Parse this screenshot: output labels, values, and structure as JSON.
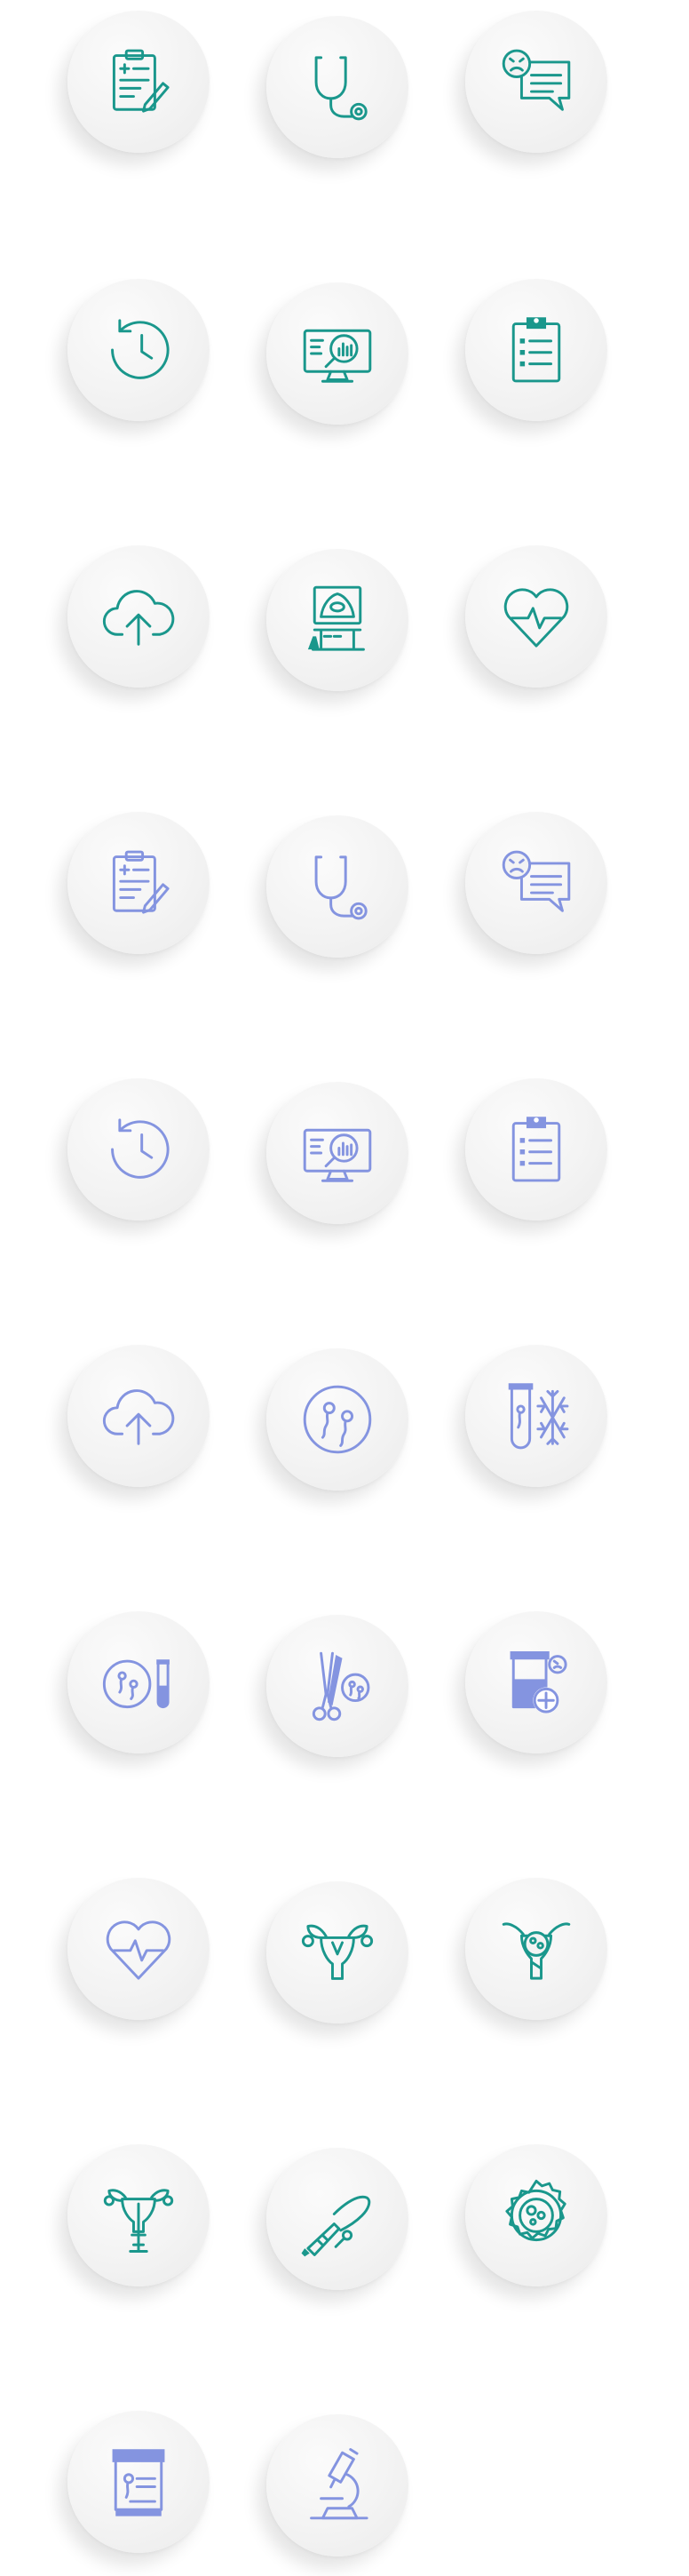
{
  "sheet": {
    "background": "#ffffff",
    "tile_background": "#f3f3f3",
    "colors": {
      "teal": "#1a978c",
      "periwinkle": "#8494e0"
    }
  },
  "icons": [
    {
      "name": "medical-report-icon",
      "color": "teal"
    },
    {
      "name": "stethoscope-icon",
      "color": "teal"
    },
    {
      "name": "chat-consultation-icon",
      "color": "teal"
    },
    {
      "name": "history-clock-icon",
      "color": "teal"
    },
    {
      "name": "monitor-analysis-icon",
      "color": "teal"
    },
    {
      "name": "clipboard-checklist-icon",
      "color": "teal"
    },
    {
      "name": "cloud-upload-icon",
      "color": "teal"
    },
    {
      "name": "ultrasound-machine-icon",
      "color": "teal"
    },
    {
      "name": "heart-pulse-icon",
      "color": "teal"
    },
    {
      "name": "medical-report-icon",
      "color": "periwinkle"
    },
    {
      "name": "stethoscope-icon",
      "color": "periwinkle"
    },
    {
      "name": "chat-consultation-icon",
      "color": "periwinkle"
    },
    {
      "name": "history-clock-icon",
      "color": "periwinkle"
    },
    {
      "name": "monitor-analysis-icon",
      "color": "periwinkle"
    },
    {
      "name": "clipboard-checklist-icon",
      "color": "periwinkle"
    },
    {
      "name": "cloud-upload-icon",
      "color": "periwinkle"
    },
    {
      "name": "sperm-petri-dish-icon",
      "color": "periwinkle"
    },
    {
      "name": "sperm-freezing-icon",
      "color": "periwinkle"
    },
    {
      "name": "sperm-sample-tube-icon",
      "color": "periwinkle"
    },
    {
      "name": "biopsy-forceps-icon",
      "color": "periwinkle"
    },
    {
      "name": "specimen-container-icon",
      "color": "periwinkle"
    },
    {
      "name": "heart-pulse-icon",
      "color": "periwinkle"
    },
    {
      "name": "uterus-icon",
      "color": "teal"
    },
    {
      "name": "uterus-ovary-icon",
      "color": "teal"
    },
    {
      "name": "uterus-insemination-icon",
      "color": "teal"
    },
    {
      "name": "catheter-syringe-icon",
      "color": "teal"
    },
    {
      "name": "egg-cell-icon",
      "color": "teal"
    },
    {
      "name": "lab-report-tablet-icon",
      "color": "periwinkle"
    },
    {
      "name": "microscope-icon",
      "color": "periwinkle"
    }
  ]
}
